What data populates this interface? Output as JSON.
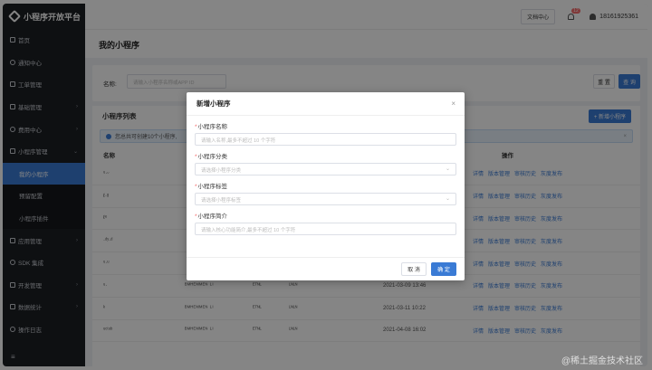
{
  "app": {
    "title": "小程序开放平台"
  },
  "sidebar": {
    "items": [
      {
        "label": "首页",
        "icon": "home-icon",
        "chevron": ""
      },
      {
        "label": "通知中心",
        "icon": "bell-icon",
        "chevron": ""
      },
      {
        "label": "工单管理",
        "icon": "ticket-icon",
        "chevron": ""
      },
      {
        "label": "基础管理",
        "icon": "settings-icon",
        "chevron": "›"
      },
      {
        "label": "费用中心",
        "icon": "money-icon",
        "chevron": "›"
      },
      {
        "label": "小程序管理",
        "icon": "app-icon",
        "chevron": "⌄"
      },
      {
        "label": "我的小程序",
        "icon": "",
        "chevron": "",
        "sub": true,
        "active": true
      },
      {
        "label": "预留配置",
        "icon": "",
        "chevron": "",
        "sub": true
      },
      {
        "label": "小程序插件",
        "icon": "",
        "chevron": "",
        "sub": true
      },
      {
        "label": "应用管理",
        "icon": "grid-icon",
        "chevron": "›"
      },
      {
        "label": "SDK 集成",
        "icon": "code-icon",
        "chevron": ""
      },
      {
        "label": "开发管理",
        "icon": "dev-icon",
        "chevron": "›"
      },
      {
        "label": "数据统计",
        "icon": "chart-icon",
        "chevron": "›"
      },
      {
        "label": "操作日志",
        "icon": "log-icon",
        "chevron": ""
      }
    ],
    "collapse_icon": "≡"
  },
  "topbar": {
    "doc_label": "文档中心",
    "badge": "12",
    "username": "18161925361"
  },
  "page": {
    "title": "我的小程序"
  },
  "filter": {
    "name_label": "名称:",
    "name_placeholder": "请输入小程序名称或APP ID",
    "reset_label": "重 置",
    "query_label": "查 询"
  },
  "list": {
    "title": "小程序列表",
    "add_label": "+ 新增小程序",
    "notice": "您总共可创建10个小程序,",
    "notice_close": "×",
    "header_name": "名称",
    "header_ops": "操作",
    "ops": [
      "详情",
      "版本管理",
      "审核历史",
      "灰度发布"
    ],
    "rows": [
      {
        "name": "ᵘ·ᵕ",
        "desc": "",
        "tag": "",
        "cat": "",
        "time": ""
      },
      {
        "name": "ℓ·ᵍ",
        "desc": "",
        "tag": "",
        "cat": "",
        "time": ""
      },
      {
        "name": "ℓᵉ",
        "desc": "",
        "tag": "",
        "cat": "",
        "time": ""
      },
      {
        "name": "·ᵈʸ·ᵈ",
        "desc": "",
        "tag": "",
        "cat": "",
        "time": ""
      },
      {
        "name": "ᵘ·ᵘ",
        "desc": "",
        "tag": "",
        "cat": "",
        "time": ""
      },
      {
        "name": "ᵘ·",
        "desc": "ᴮᴹᴴᴱᴹᴹᴱᴺ ᴸᴵ",
        "tag": "ᴱᵀᴺᴸ",
        "cat": "ᴸᴺᴸᴺ",
        "time": "2021-03-09 13:46"
      },
      {
        "name": "ᵏ",
        "desc": "ᴮᴹᴴᴱᴹᴹᴱᴺ ᴸᴵ",
        "tag": "ᴱᵀᴺᴸ",
        "cat": "ᴸᴺᴸᴺ",
        "time": "2021-03-11 10:22"
      },
      {
        "name": "ᵘᶜᵗᵘᵇ",
        "desc": "ᴮᴹᴴᴱᴹᴹᴱᴺ ᴸᴵ",
        "tag": "ᴱᵀᴺᴸ",
        "cat": "ᴸᴺᴸᴺ",
        "time": "2021-04-08 16:02"
      }
    ]
  },
  "modal": {
    "title": "新增小程序",
    "close": "×",
    "fields": [
      {
        "label": "小程序名称",
        "placeholder": "请输入名称,最多不超过 10 个字符",
        "arrow": ""
      },
      {
        "label": "小程序分类",
        "placeholder": "请选择小程序分类",
        "arrow": "⌄"
      },
      {
        "label": "小程序标签",
        "placeholder": "请选择小程序标签",
        "arrow": "⌄"
      },
      {
        "label": "小程序简介",
        "placeholder": "请输入核心功能简介,最多不超过 10 个字符",
        "arrow": ""
      }
    ],
    "cancel_label": "取 消",
    "ok_label": "确 定"
  },
  "watermark": "@稀土掘金技术社区"
}
